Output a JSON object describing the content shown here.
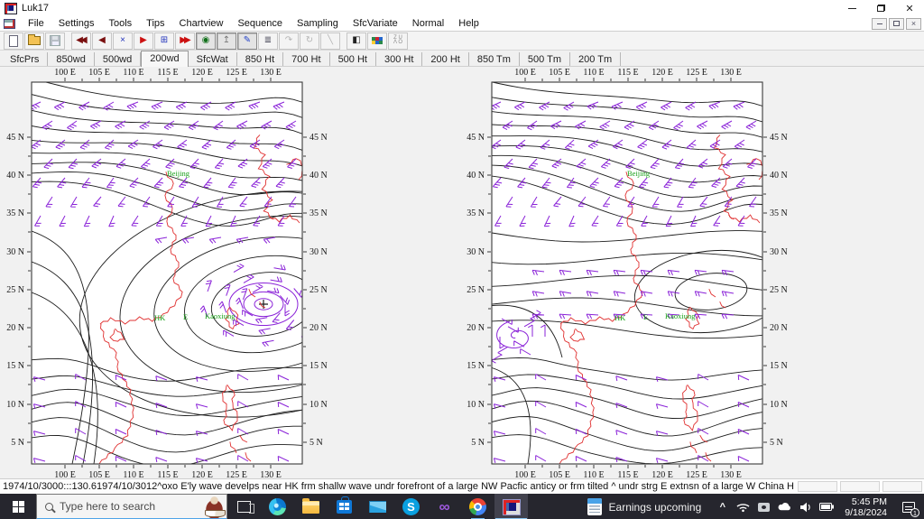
{
  "window": {
    "title": "Luk17"
  },
  "menu": {
    "items": [
      "File",
      "Settings",
      "Tools",
      "Tips",
      "Chartview",
      "Sequence",
      "Sampling",
      "SfcVariate",
      "Normal",
      "Help"
    ]
  },
  "toolbar": {
    "buttons": [
      {
        "name": "new-file",
        "shape": "page"
      },
      {
        "name": "open-file",
        "shape": "folder"
      },
      {
        "name": "save-file",
        "shape": "floppy",
        "disabled": true
      },
      {
        "name": "separator"
      },
      {
        "name": "jump-start",
        "glyph": "◀◀",
        "color": "#7a1010"
      },
      {
        "name": "step-back",
        "glyph": "◀",
        "color": "#7a1010"
      },
      {
        "name": "cancel-cross",
        "glyph": "×",
        "color": "#2233bb"
      },
      {
        "name": "play-forward",
        "glyph": "▶",
        "color": "#cc1111"
      },
      {
        "name": "frame-select",
        "glyph": "⊞",
        "color": "#2233bb"
      },
      {
        "name": "fast-forward",
        "glyph": "▶▶",
        "color": "#cc1111"
      },
      {
        "name": "globe",
        "glyph": "◉",
        "color": "#11701a",
        "pressed": true
      },
      {
        "name": "station-staff",
        "glyph": "↥",
        "color": "#777",
        "pressed": true
      },
      {
        "name": "pen-annotate",
        "glyph": "✎",
        "color": "#2141c8",
        "pressed": true
      },
      {
        "name": "isopleth-dashes",
        "glyph": "≣",
        "color": "#445"
      },
      {
        "name": "curve-arrow",
        "glyph": "↷",
        "color": "#999",
        "disabled": true
      },
      {
        "name": "spiral-tool",
        "glyph": "↻",
        "color": "#999",
        "disabled": true
      },
      {
        "name": "node-line",
        "glyph": "╲",
        "color": "#999",
        "disabled": true
      },
      {
        "name": "separator"
      },
      {
        "name": "panel-layout",
        "glyph": "◧",
        "color": "#222"
      },
      {
        "name": "pixel-palette",
        "shape": "pixels"
      },
      {
        "name": "zu-sort",
        "shape": "zu",
        "text": "Z U\nΛ O"
      }
    ]
  },
  "tabs": {
    "items": [
      "SfcPrs",
      "850wd",
      "500wd",
      "200wd",
      "SfcWat",
      "850 Ht",
      "700 Ht",
      "500 Ht",
      "300 Ht",
      "200 Ht",
      "850 Tm",
      "500 Tm",
      "200 Tm"
    ],
    "active": "200wd"
  },
  "maps": {
    "lon_labels": [
      "100 E",
      "105 E",
      "110 E",
      "115 E",
      "120 E",
      "125 E",
      "130 E"
    ],
    "lat_labels": [
      "45 N",
      "40 N",
      "35 N",
      "30 N",
      "25 N",
      "20 N",
      "15 N",
      "10 N",
      "5 N"
    ],
    "stations": {
      "beijing": "Beijing",
      "hk": "HK",
      "e": "E",
      "kaoxiung": "Kaoxiung"
    },
    "colors": {
      "contour": "#1c1c1c",
      "wind": "#8a22d8",
      "coast": "#e03030",
      "station": "#18a018",
      "frame": "#3a3a3a"
    }
  },
  "status_bar": {
    "text": "1974/10/3000:::130.61974/10/3012^oxo   E'ly wave develps near HK frm shallw wave undr forefront of a large NW Pacfic anticy or frm tilted ^ undr strg E extnsn of a large W China H"
  },
  "taskbar": {
    "search_placeholder": "Type here to search",
    "widget_label": "Earnings upcoming",
    "clock": {
      "time": "5:45 PM",
      "date": "9/18/2024"
    },
    "notification_count": "1",
    "apps": [
      "task-view",
      "edge",
      "file-explorer",
      "store",
      "mail",
      "skype",
      "visual-studio",
      "chrome",
      "luk17"
    ]
  }
}
